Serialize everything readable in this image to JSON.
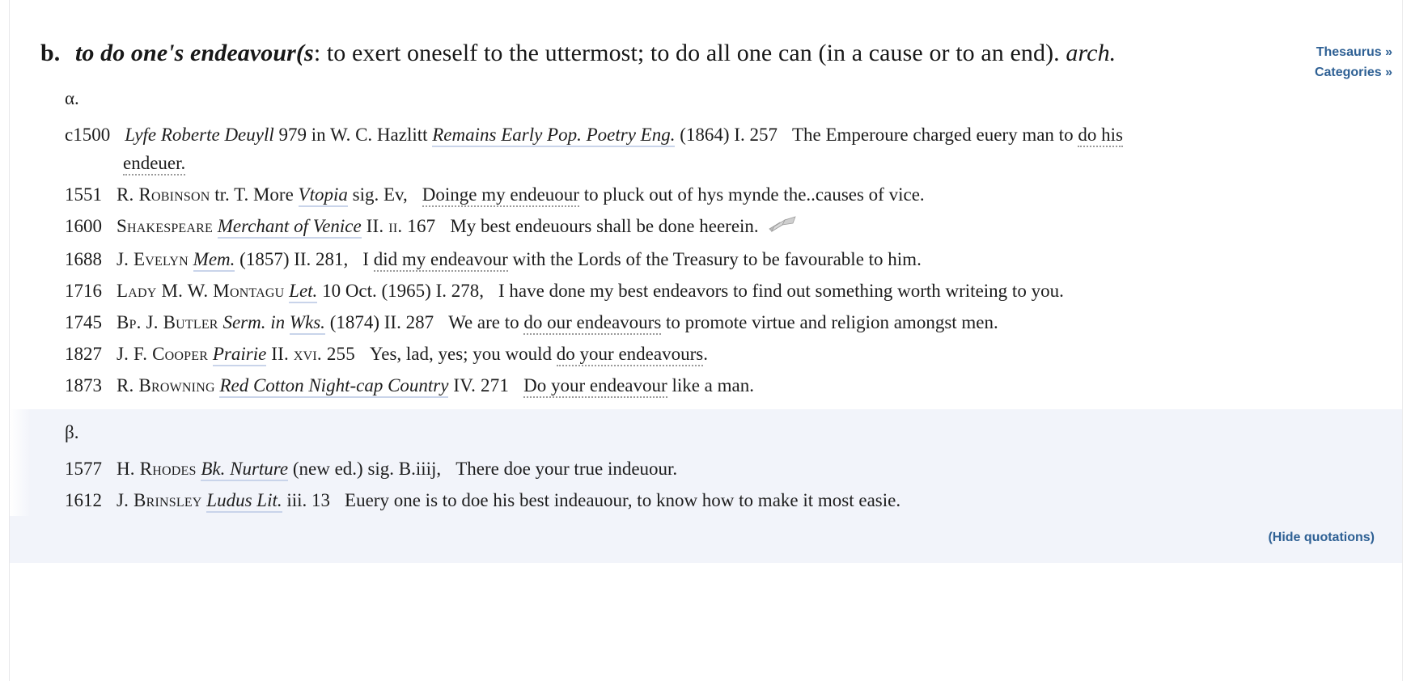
{
  "sense": {
    "letter": "b.",
    "phrase": "to do one's endeavour(s",
    "definition": ": to exert oneself to the uttermost; to do all one can (in a cause or to an end).",
    "label": "arch."
  },
  "side_links": [
    {
      "label": "Thesaurus »",
      "name": "thesaurus-link"
    },
    {
      "label": "Categories »",
      "name": "categories-link"
    }
  ],
  "groups": [
    {
      "label": "α.",
      "shaded": false,
      "quotations": [
        {
          "date": "c1500",
          "author": "",
          "work": "Lyfe Roberte Deuyll",
          "ref_a": "979 in W. C. Hazlitt ",
          "work2": "Remains Early Pop. Poetry Eng.",
          "ref_b": " (1864) I. 257",
          "text_pre": "The Emperoure charged euery man to ",
          "keyword": "do his endeuer.",
          "text_post": "",
          "wrapped": true,
          "keyword_head": "do his",
          "keyword_tail": "endeuer.",
          "icon": false
        },
        {
          "date": "1551",
          "author": "R. Robinson",
          "ref_a": " tr. T. More ",
          "work": "Vtopia",
          "ref_b": " sig. Ev,",
          "text_pre": "",
          "keyword": "Doinge my endeuour",
          "text_post": " to pluck out of hys mynde the..causes of vice.",
          "icon": false
        },
        {
          "date": "1600",
          "author": "Shakespeare",
          "ref_a": " ",
          "work": "Merchant of Venice",
          "ref_b": " II. ii. 167",
          "ref_b_sc": "II",
          "text_pre": "My best endeuours shall be done heerein.",
          "keyword": "",
          "text_post": "",
          "icon": true,
          "icon_name": "open-book-icon"
        },
        {
          "date": "1688",
          "author": "J. Evelyn",
          "ref_a": " ",
          "work": "Mem.",
          "ref_b": " (1857) II. 281,",
          "text_pre": "I ",
          "keyword": "did my endeavour",
          "text_post": " with the Lords of the Treasury to be favourable to him.",
          "icon": false
        },
        {
          "date": "1716",
          "author": "Lady M. W. Montagu",
          "ref_a": " ",
          "work": "Let.",
          "ref_b": " 10 Oct. (1965) I. 278,",
          "text_pre": "I have done my best endeavors to find out something worth writeing to you.",
          "keyword": "",
          "text_post": "",
          "icon": false
        },
        {
          "date": "1745",
          "author": "Bp. J. Butler",
          "ref_a": " Serm. in ",
          "work": "Wks.",
          "ref_b": " (1874) II. 287",
          "text_pre": "We are to ",
          "keyword": "do our endeavours",
          "text_post": " to promote virtue and religion amongst men.",
          "icon": false
        },
        {
          "date": "1827",
          "author": "J. F. Cooper",
          "ref_a": " ",
          "work": "Prairie",
          "ref_b": " II. xvi. 255",
          "text_pre": "Yes, lad, yes; you would ",
          "keyword": "do your endeavours",
          "text_post": ".",
          "icon": false
        },
        {
          "date": "1873",
          "author": "R. Browning",
          "ref_a": " ",
          "work": "Red Cotton Night-cap Country",
          "ref_b": " IV. 271",
          "text_pre": "",
          "keyword": "Do your endeavour",
          "text_post": " like a man.",
          "icon": false
        }
      ]
    },
    {
      "label": "β.",
      "shaded": true,
      "quotations": [
        {
          "date": "1577",
          "author": "H. Rhodes",
          "ref_a": " ",
          "work": "Bk. Nurture",
          "ref_b": " (new ed.) sig. B.iiij,",
          "text_pre": "There doe your true indeuour.",
          "keyword": "",
          "text_post": "",
          "icon": false
        },
        {
          "date": "1612",
          "author": "J. Brinsley",
          "ref_a": " ",
          "work": "Ludus Lit.",
          "ref_b": " iii. 13",
          "text_pre": "Euery one is to doe his best indeauour, to know how to make it most easie.",
          "keyword": "",
          "text_post": "",
          "icon": false
        }
      ]
    }
  ],
  "footer": {
    "hide_quotations": "(Hide quotations)"
  },
  "colors": {
    "link": "#2e6094",
    "work_underline": "#c9d4ea",
    "keyword_underline": "#9a9a9a",
    "shaded_background": "#f2f4fa",
    "text": "#1d1d1d"
  }
}
